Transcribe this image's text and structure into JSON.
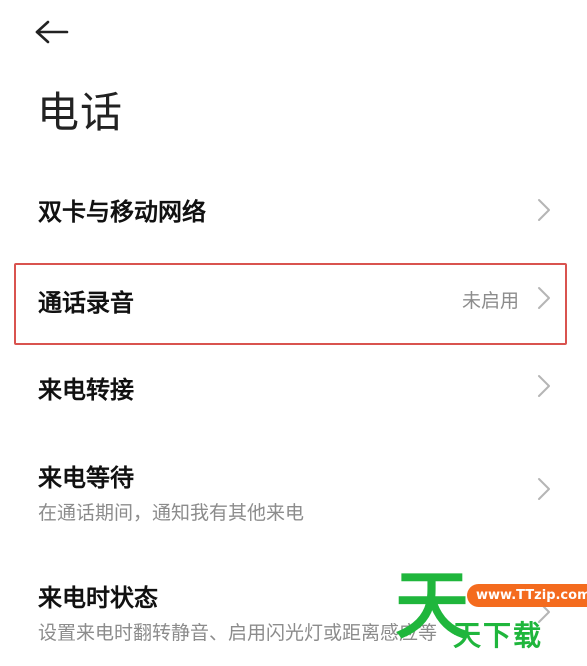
{
  "header": {
    "back_icon": "arrow-left-icon",
    "title": "电话"
  },
  "settings": [
    {
      "label": "双卡与移动网络",
      "value": "",
      "subtitle": ""
    },
    {
      "label": "通话录音",
      "value": "未启用",
      "subtitle": ""
    },
    {
      "label": "来电转接",
      "value": "",
      "subtitle": ""
    },
    {
      "label": "来电等待",
      "value": "",
      "subtitle": "在通话期间，通知我有其他来电"
    },
    {
      "label": "来电时状态",
      "value": "",
      "subtitle": "设置来电时翻转静音、启用闪光灯或距离感应等"
    }
  ],
  "highlight": {
    "color": "#d9534f"
  },
  "watermark": {
    "big_char": "天",
    "url": "www.TTzip.com",
    "text": "天下载",
    "brand_color": "#1fb63c",
    "badge_color": "#f46b1e"
  },
  "icons": {
    "chevron": "chevron-right-icon"
  }
}
